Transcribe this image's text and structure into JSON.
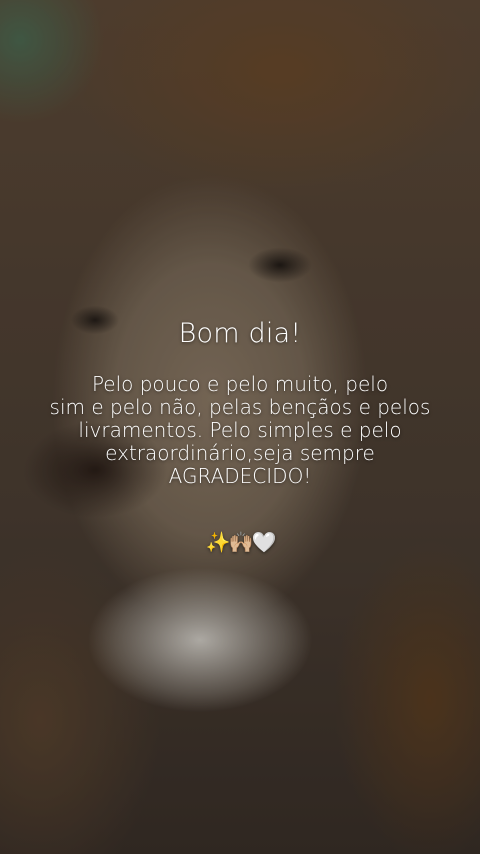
{
  "image": {
    "subject": "lion-face-photo"
  },
  "greeting": "Bom dia!",
  "message_lines": [
    "Pelo pouco e pelo muito, pelo",
    "sim e pelo não, pelas bençãos e pelos",
    "livramentos. Pelo simples e pelo",
    "extraordinário,seja sempre",
    "AGRADECIDO!"
  ],
  "emoji": "✨🙌🏼🤍"
}
